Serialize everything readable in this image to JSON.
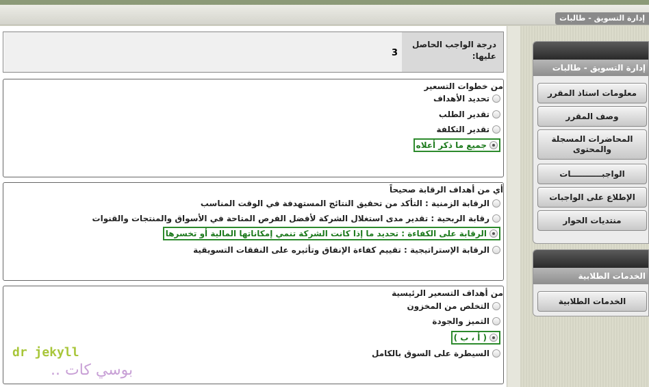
{
  "header": {
    "title": "إدارة التسويق - طالبات"
  },
  "grade": {
    "label": "درجة الواجب الحاصل عليها:",
    "value": "3"
  },
  "questions": [
    {
      "title": "من خطوات التسعير",
      "options": [
        {
          "label": "تحديد الأهداف",
          "checked": false,
          "correct": false
        },
        {
          "label": "تقدير الطلب",
          "checked": false,
          "correct": false
        },
        {
          "label": "تقدير التكلفة",
          "checked": false,
          "correct": false
        },
        {
          "label": "جميع ما ذكر أعلاه",
          "checked": true,
          "correct": true
        }
      ]
    },
    {
      "title": "أي من أهداف الرقابة صحيحاً",
      "options": [
        {
          "label": "الرقابة الزمنية : التأكد من تحقيق النتائج المستهدفة في الوقت المناسب",
          "checked": false,
          "correct": false
        },
        {
          "label": "رقابة الربحية : تقدير مدى استغلال الشركة لأفضل الفرص المتاحة في الأسواق والمنتجات والقنوات",
          "checked": false,
          "correct": false
        },
        {
          "label": "الرقابة على الكفاءة : تحديد ما إذا كانت الشركة تنمي إمكاناتها المالية أو تخسرها",
          "checked": true,
          "correct": true
        },
        {
          "label": "الرقابة الإستراتيجية : تقييم كفاءة الإنفاق وتأثيره على النفقات التسويقية",
          "checked": false,
          "correct": false
        }
      ]
    },
    {
      "title": "من أهداف التسعير الرئيسية",
      "options": [
        {
          "label": "التخلص من المخزون",
          "checked": false,
          "correct": false
        },
        {
          "label": "التميز والجودة",
          "checked": false,
          "correct": false
        },
        {
          "label": "( أ ، ب )",
          "checked": true,
          "correct": true
        },
        {
          "label": "السيطرة على السوق بالكامل",
          "checked": false,
          "correct": false
        }
      ]
    }
  ],
  "watermark": {
    "line1": "dr jekyll",
    "line2": "بوسي كات .."
  },
  "sidebar": {
    "panel1_title": "إدارة التسويق - طالبات",
    "menu": [
      "معلومات استاذ المقرر",
      "وصف المقرر",
      "المحاضرات المسجلة والمحتوى",
      "الواجبـــــــــــات",
      "الإطلاع على الواجبات",
      "منتديات الحوار"
    ],
    "panel2_title": "الخدمات الطلابية",
    "services": [
      "الخدمات الطلابية"
    ]
  }
}
